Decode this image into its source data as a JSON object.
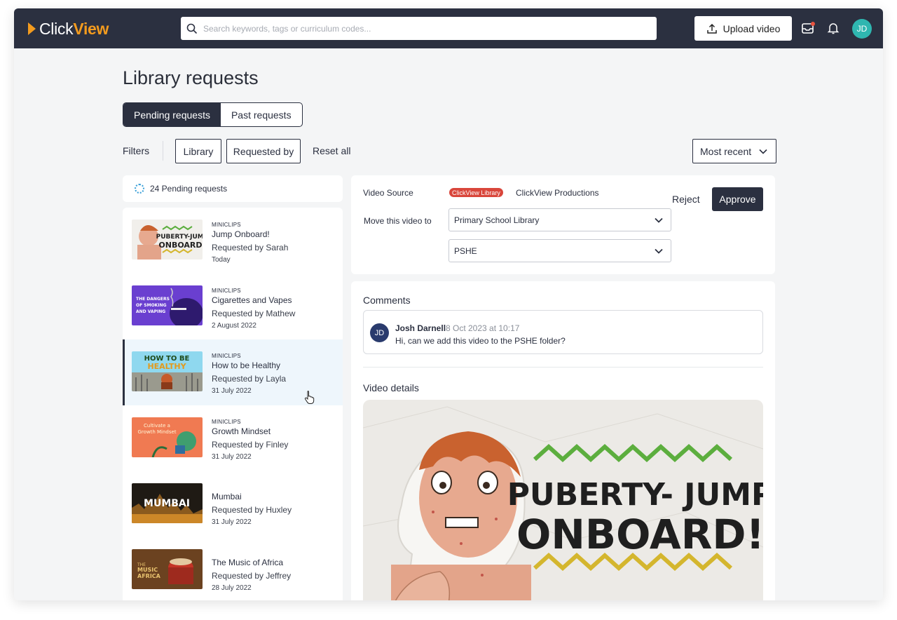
{
  "app": {
    "logo_click": "Click",
    "logo_view": "View",
    "search_placeholder": "Search keywords, tags or curriculum codes...",
    "upload_label": "Upload video",
    "user_initials": "JD"
  },
  "page": {
    "title": "Library requests",
    "tabs": [
      {
        "label": "Pending requests",
        "active": true
      },
      {
        "label": "Past requests",
        "active": false
      }
    ],
    "filters_label": "Filters",
    "filter_buttons": [
      "Library",
      "Requested by"
    ],
    "reset_label": "Reset all",
    "sort_label": "Most recent"
  },
  "requests": {
    "pending_count_label": "24 Pending requests",
    "items": [
      {
        "tag": "MINICLIPS",
        "title": "Jump Onboard!",
        "requested_by": "Requested by Sarah",
        "date": "Today",
        "thumb_text": "PUBERTY- JUMP ONBOARD!"
      },
      {
        "tag": "MINICLIPS",
        "title": "Cigarettes and Vapes",
        "requested_by": "Requested by Mathew",
        "date": "2 August 2022",
        "thumb_text": "THE DANGERS OF SMOKING AND VAPING"
      },
      {
        "tag": "MINICLIPS",
        "title": "How to be Healthy",
        "requested_by": "Requested by Layla",
        "date": "31 July 2022",
        "thumb_text": "HOW TO BE HEALTHY"
      },
      {
        "tag": "MINICLIPS",
        "title": "Growth Mindset",
        "requested_by": "Requested by Finley",
        "date": "31 July 2022",
        "thumb_text": "Cultivate a Growth Mindset"
      },
      {
        "tag": "",
        "title": "Mumbai",
        "requested_by": "Requested by Huxley",
        "date": "31 July 2022",
        "thumb_text": "MUMBAI"
      },
      {
        "tag": "",
        "title": "The Music of Africa",
        "requested_by": "Requested by Jeffrey",
        "date": "28 July 2022",
        "thumb_text": "THE MUSIC OF AFRICA"
      }
    ]
  },
  "detail": {
    "video_source_label": "Video Source",
    "source_badge": "ClickView Library",
    "source_name": "ClickView Productions",
    "move_label": "Move this video to",
    "library_select": "Primary School Library",
    "folder_select": "PSHE",
    "reject_label": "Reject",
    "approve_label": "Approve",
    "comments_title": "Comments",
    "comment": {
      "initials": "JD",
      "author": "Josh Darnell",
      "time": "8 Oct 2023 at 10:17",
      "text": "Hi, can we add this video to the PSHE folder?"
    },
    "video_details_title": "Video details",
    "preview_title_line1": "PUBERTY- JUMP",
    "preview_title_line2": "ONBOARD!"
  },
  "colors": {
    "topbar": "#2b3040",
    "accent": "#f39b1e",
    "avatar": "#2fb6b0",
    "badge": "#d9463b"
  }
}
